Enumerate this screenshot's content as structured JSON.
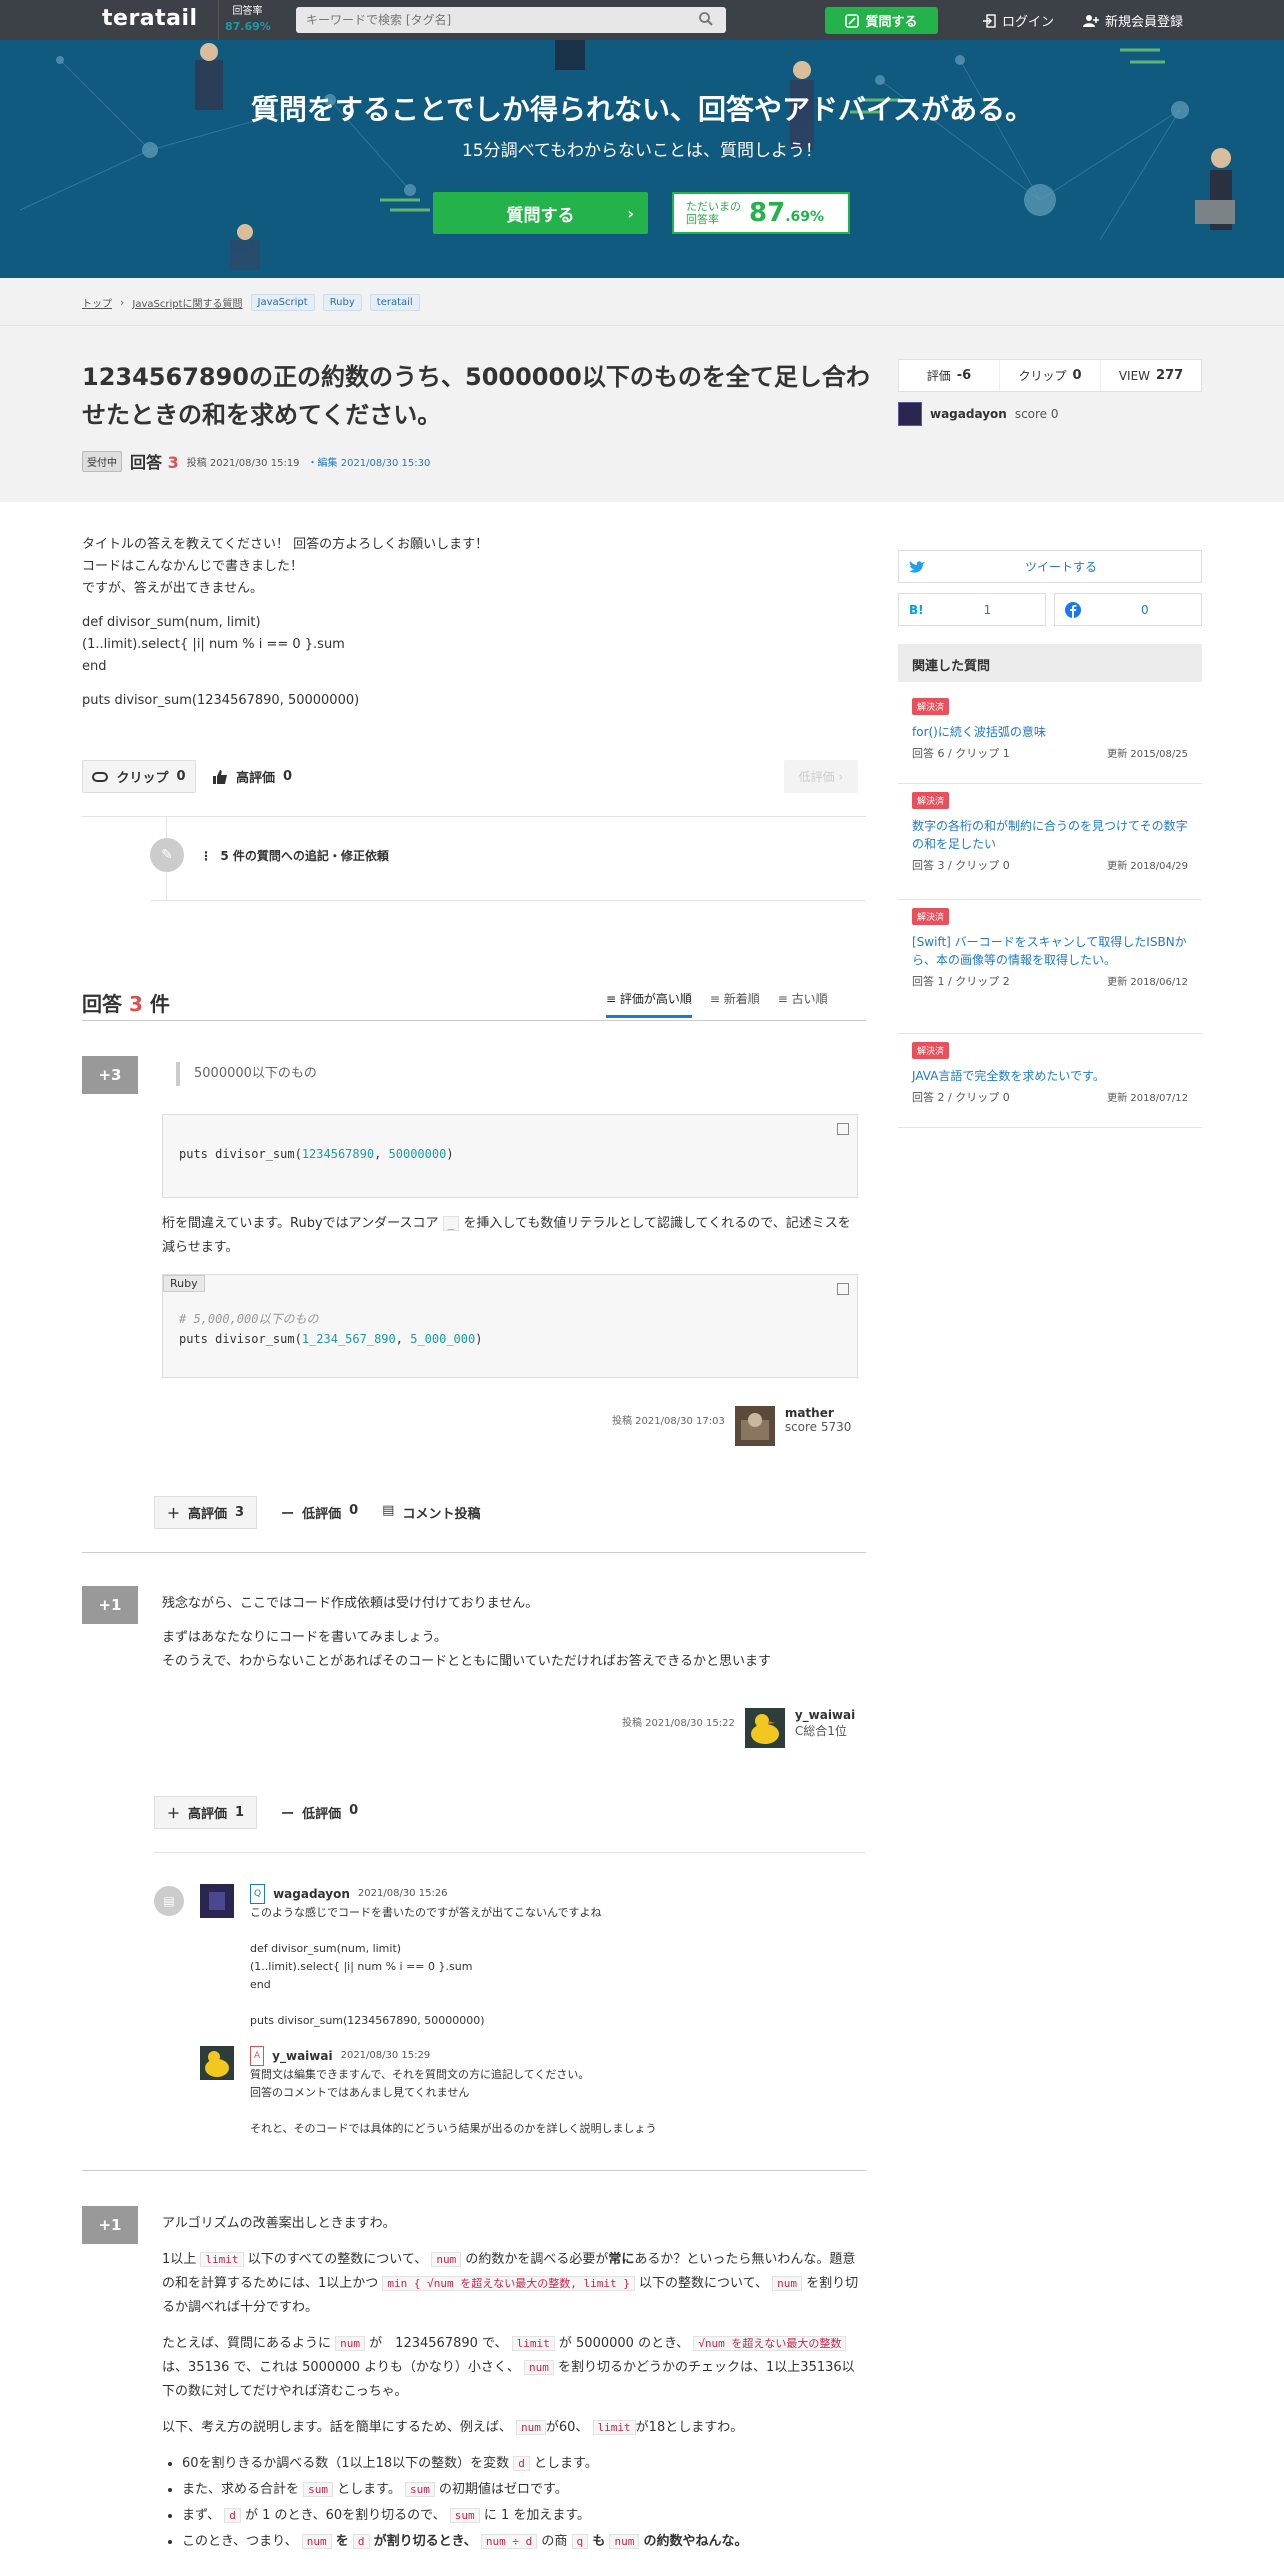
{
  "header": {
    "logo": "teratail",
    "rate_label": "回答率",
    "rate_value": "87.69%",
    "search_placeholder": "キーワードで検索 [タグ名]",
    "ask_button": "質問する",
    "login": "ログイン",
    "register": "新規会員登録"
  },
  "hero": {
    "title": "質問をすることでしか得られない、回答やアドバイスがある。",
    "subtitle": "15分調べてもわからないことは、質問しよう！",
    "ask_button": "質問する",
    "rate_label_1": "ただいまの",
    "rate_label_2": "回答率",
    "rate_big": "87",
    "rate_small": ".69%"
  },
  "breadcrumb": {
    "top": "トップ",
    "sep": "›",
    "parent": "JavaScriptに関する質問",
    "tags": [
      "JavaScript",
      "Ruby",
      "teratail"
    ]
  },
  "question": {
    "title": "1234567890の正の約数のうち、5000000以下のものを全て足し合わせたときの和を求めてください。",
    "status": "受付中",
    "answers_label": "回答",
    "answers_count": "3",
    "posted": "投稿 2021/08/30 15:19",
    "edited": "・編集 2021/08/30 15:30",
    "stats": {
      "rating_label": "評価",
      "rating": "-6",
      "clip_label": "クリップ",
      "clip": "0",
      "view_label": "VIEW",
      "view": "277"
    },
    "author": "wagadayon",
    "author_score": "score 0",
    "body": [
      "タイトルの答えを教えてください！ 回答の方よろしくお願いします！",
      "コードはこんなかんじで書きました！",
      "ですが、答えが出てきません。",
      "def divisor_sum(num, limit)",
      "(1..limit).select{ |i| num % i == 0 }.sum",
      "end",
      "puts divisor_sum(1234567890, 50000000)"
    ],
    "clip_button": "クリップ",
    "clip_count": "0",
    "high_button": "高評価",
    "high_count": "0",
    "low_button": "低評価",
    "edit_requests": "5 件の質問への追記・修正依頼"
  },
  "answers_section": {
    "label": "回答",
    "count": "3",
    "suffix": "件",
    "sort": [
      "評価が高い順",
      "新着順",
      "古い順"
    ]
  },
  "answer1": {
    "score": "+3",
    "quote": "5000000以下のもの",
    "code1_fn": "puts divisor_sum(",
    "code1_a": "1234567890",
    "code1_sep": ", ",
    "code1_b": "50000000",
    "code1_end": ")",
    "text": "桁を間違えています。Rubyではアンダースコア",
    "underscore": "_",
    "text2": "を挿入しても数値リテラルとして認識してくれるので、記述ミスを減らせます。",
    "lang": "Ruby",
    "code2_comment": "# 5,000,000以下のもの",
    "code2_fn": "puts divisor_sum(",
    "code2_a": "1_234_567_890",
    "code2_sep": ", ",
    "code2_b": "5_000_000",
    "code2_end": ")",
    "posted": "投稿 2021/08/30 17:03",
    "user": "mather",
    "user_score": "score 5730",
    "high": "高評価",
    "high_count": "3",
    "low": "低評価",
    "low_count": "0",
    "comment": "コメント投稿"
  },
  "answer2": {
    "score": "+1",
    "line1": "残念ながら、ここではコード作成依頼は受け付けておりません。",
    "line2": "まずはあなたなりにコードを書いてみましょう。",
    "line3": "そのうえで、わからないことがあればそのコードとともに聞いていただければお答えできるかと思います",
    "posted": "投稿 2021/08/30 15:22",
    "user": "y_waiwai",
    "user_rank": "C総合1位",
    "high": "高評価",
    "high_count": "1",
    "low": "低評価",
    "low_count": "0"
  },
  "comments": [
    {
      "role": "Q",
      "user": "wagadayon",
      "date": "2021/08/30 15:26",
      "lines": [
        "このような感じでコードを書いたのですが答えが出てこないんですよね",
        "",
        "def divisor_sum(num, limit)",
        "(1..limit).select{ |i| num % i == 0 }.sum",
        "end",
        "",
        "puts divisor_sum(1234567890, 50000000)"
      ]
    },
    {
      "role": "A",
      "user": "y_waiwai",
      "date": "2021/08/30 15:29",
      "lines": [
        "質問文は編集できますんで、それを質問文の方に追記してください。",
        "回答のコメントではあんまし見てくれません",
        "",
        "それと、そのコードでは具体的にどういう結果が出るのかを詳しく説明しましょう"
      ]
    }
  ],
  "answer3": {
    "score": "+1",
    "intro": "アルゴリズムの改善案出しときますわ。",
    "p1a": "1以上",
    "p1_limit": "limit",
    "p1b": "以下のすべての整数について、",
    "p1_num": "num",
    "p1c": "の約数かを調べる必要が",
    "p1_strong": "常に",
    "p1d": "あるか？といったら無いわんな。題意の和を計算するためには、1以上かつ",
    "p1_min": "min { √num を超えない最大の整数, limit }",
    "p1e": "以下の整数について、",
    "p1_num2": "num",
    "p1f": "を割り切るか調べれば十分ですわ。",
    "p2a": "たとえば、質問にあるように",
    "p2_num": "num",
    "p2b": "が　1234567890 で、",
    "p2_limit": "limit",
    "p2c": "が 5000000 のとき、",
    "p2_sqrt": "√num を超えない最大の整数",
    "p2d": "は、35136 で、これは 5000000 よりも（かなり）小さく、",
    "p2_num2": "num",
    "p2e": "を割り切るかどうかのチェックは、1以上35136以下の数に対してだけやれば済むこっちゃ。",
    "p3a": "以下、考え方の説明します。話を簡単にするため、例えば、",
    "p3_num": "num",
    "p3b": "が60、",
    "p3_limit": "limit",
    "p3c": "が18としますわ。",
    "li1a": "60を割りきるか調べる数（1以上18以下の整数）を変数",
    "li1_d": "d",
    "li1b": "とします。",
    "li2a": "また、求める合計を",
    "li2_sum": "sum",
    "li2b": "とします。",
    "li2_sum2": "sum",
    "li2c": "の初期値はゼロです。",
    "li3a": "まず、",
    "li3_d": "d",
    "li3b": "が 1 のとき、60を割り切るので、",
    "li3_sum": "sum",
    "li3c": "に 1 を加えます。",
    "li4a": "このとき、つまり、",
    "li4_num": "num",
    "li4b": "を",
    "li4_d": "d",
    "li4c": "が割り切るとき、",
    "li4_q": "num ÷ d",
    "li4d": "の商",
    "li4_q2": "q",
    "li4e": "も",
    "li4_num2": "num",
    "li4f": "の約数やねんな。"
  },
  "sidebar": {
    "tweet": "ツイートする",
    "hatena_label": "B!",
    "hatena_count": "1",
    "fb_count": "0",
    "related_title": "関連した質問",
    "related": [
      {
        "badge": "解決済",
        "title": "for()に続く波括弧の意味",
        "meta": "回答 6 / クリップ 1",
        "date": "更新 2015/08/25"
      },
      {
        "badge": "解決済",
        "title": "数字の各桁の和が制約に合うのを見つけてその数字の和を足したい",
        "meta": "回答 3 / クリップ 0",
        "date": "更新 2018/04/29"
      },
      {
        "badge": "解決済",
        "title": "[Swift] バーコードをスキャンして取得したISBNから、本の画像等の情報を取得したい。",
        "meta": "回答 1 / クリップ 2",
        "date": "更新 2018/06/12"
      },
      {
        "badge": "解決済",
        "title": "JAVA言語で完全数を求めたいです。",
        "meta": "回答 2 / クリップ 0",
        "date": "更新 2018/07/12"
      }
    ]
  },
  "colors": {
    "header_bg": "#3c4148",
    "hero_bg": "#0f5a7e",
    "green": "#24b24a",
    "link": "#1f7ac9",
    "accent_red": "#d9534f"
  }
}
